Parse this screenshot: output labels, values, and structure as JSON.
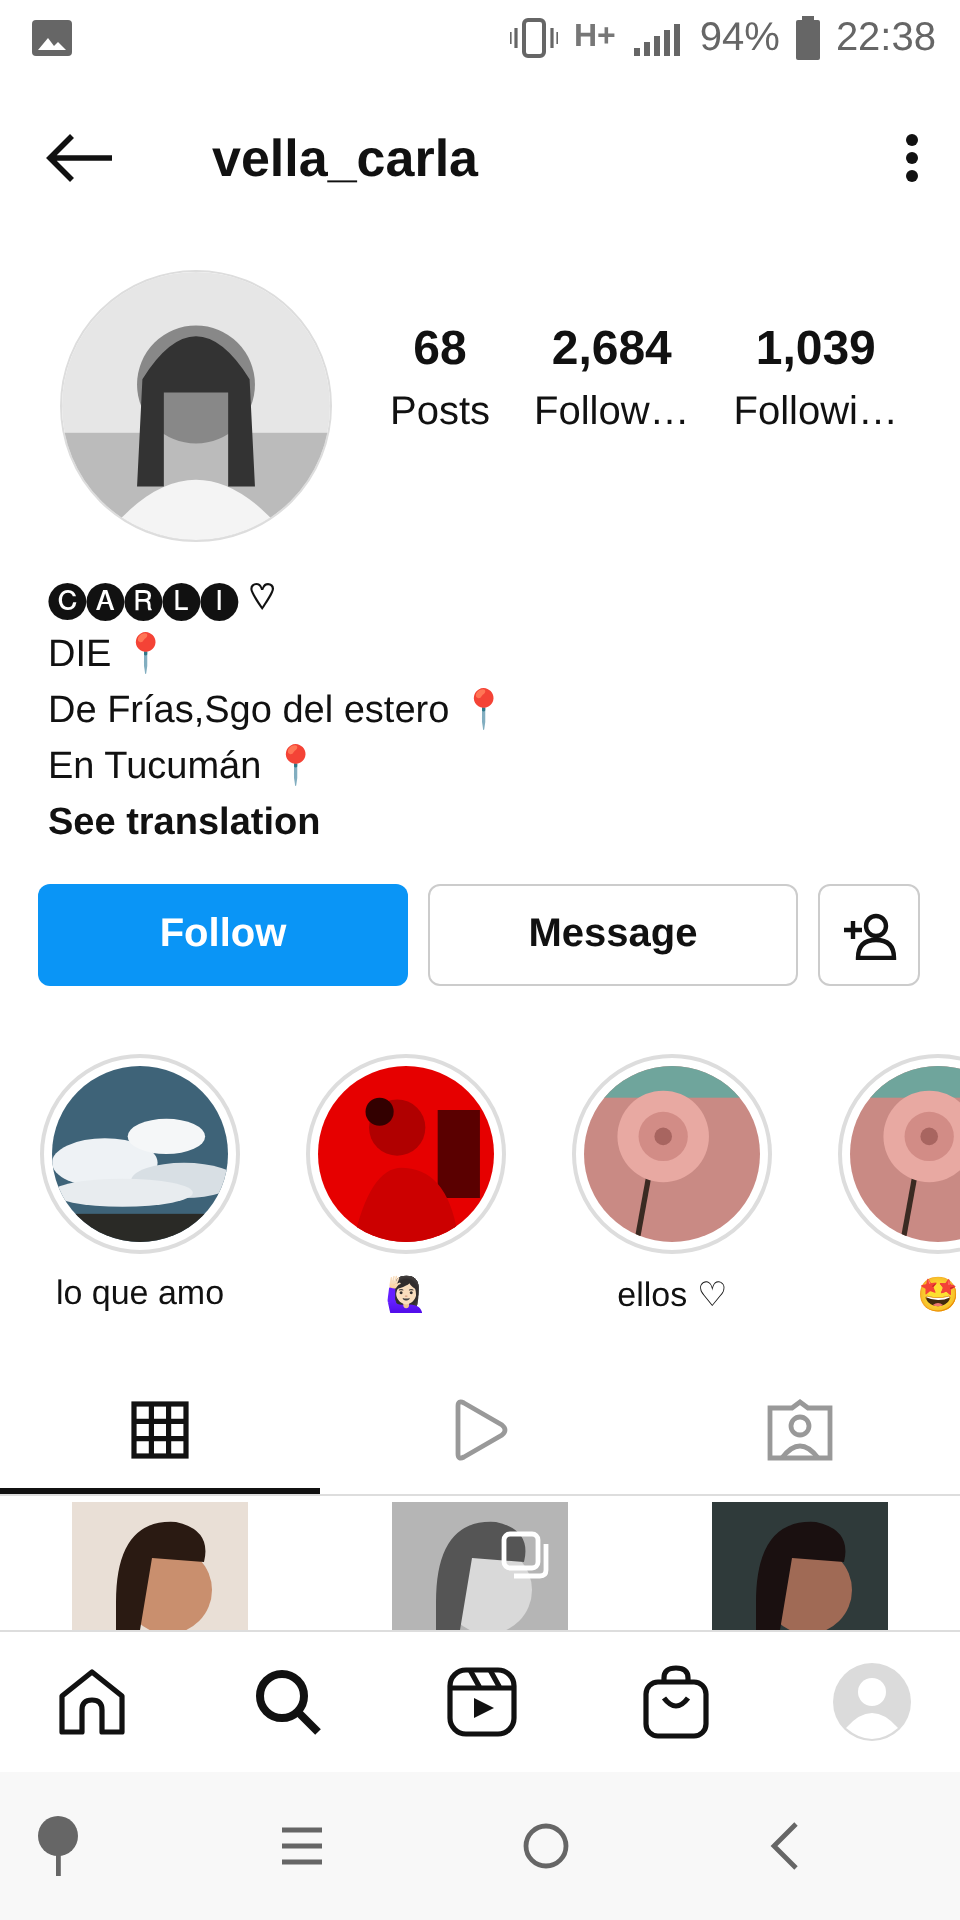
{
  "status_bar": {
    "network": "H+",
    "battery": "94%",
    "time": "22:38"
  },
  "header": {
    "username": "vella_carla"
  },
  "stats": [
    {
      "value": "68",
      "label": "Posts"
    },
    {
      "value": "2,684",
      "label": "Follow…"
    },
    {
      "value": "1,039",
      "label": "Followi…"
    }
  ],
  "bio": {
    "lines": [
      "🅒🅐🅡🅛🅘 ♡",
      "DIE 📍",
      "De Frías,Sgo del estero 📍",
      "En Tucumán 📍"
    ],
    "translation_link": "See translation"
  },
  "buttons": [
    {
      "label": "Follow",
      "kind": "primary"
    },
    {
      "label": "Message",
      "kind": "secondary"
    }
  ],
  "highlights": [
    {
      "label": "lo que amo"
    },
    {
      "label": "🙋🏻‍♀️"
    },
    {
      "label": "ellos ♡"
    },
    {
      "label": "🤩"
    }
  ],
  "tabs": [
    {
      "kind": "grid",
      "selected": true
    },
    {
      "kind": "reels",
      "selected": false
    },
    {
      "kind": "tagged",
      "selected": false
    }
  ],
  "posts": [
    {
      "multiple": false
    },
    {
      "multiple": true
    },
    {
      "multiple": false
    }
  ],
  "bottom_nav": [
    {
      "kind": "home"
    },
    {
      "kind": "search"
    },
    {
      "kind": "reels"
    },
    {
      "kind": "shop"
    },
    {
      "kind": "profile"
    }
  ]
}
